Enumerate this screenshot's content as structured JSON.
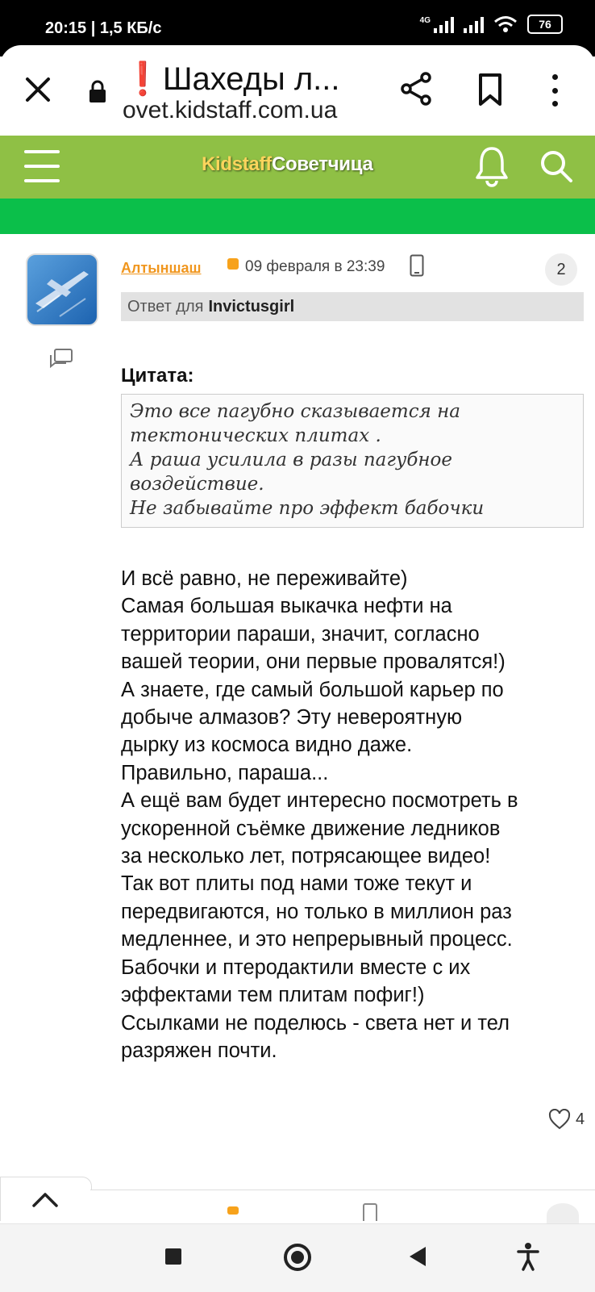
{
  "status_bar": {
    "time": "20:15 | 1,5 КБ/с",
    "network": "4G",
    "battery": "76"
  },
  "browser": {
    "tab_title_mark": "❗",
    "tab_title": "Шахеды л...",
    "url_host": "ovet.kidstaff.com.ua"
  },
  "site": {
    "logo_part1": "Kidstaff",
    "logo_part2": "Советчица",
    "brand_color": "#8fc045"
  },
  "post": {
    "author": "Алтыншаш",
    "date": "09 февраля в 23:39",
    "number": "2",
    "reply_prefix": "Ответ для",
    "reply_to": "Invictusgirl",
    "quote_label": "Цитата:",
    "quote_lines": [
      "Это все пагубно сказывается на",
      "тектонических плитах .",
      "А раша усилила в разы пагубное",
      "воздействие.",
      "Не забывайте про эффект бабочки"
    ],
    "body_lines": [
      "И всё равно, не переживайте)",
      "Самая большая выкачка нефти на",
      "территории параши, значит, согласно",
      "вашей теории, они первые провалятся!)",
      "А знаете, где самый большой карьер по",
      "добыче алмазов? Эту невероятную",
      "дырку из космоса видно даже.",
      "Правильно, параша...",
      "А ещё вам будет интересно посмотреть в",
      "ускоренной съёмке движение ледников",
      "за несколько лет, потрясающее видео!",
      "Так вот плиты под нами тоже текут и",
      "передвигаются, но только в миллион раз",
      "медленнее, и это непрерывный процесс.",
      "Бабочки и птеродактили вместе с их",
      "эффектами тем плитам пофиг!)",
      "Ссылками не поделюсь - света нет и тел",
      "разряжен почти."
    ],
    "likes": "4"
  }
}
